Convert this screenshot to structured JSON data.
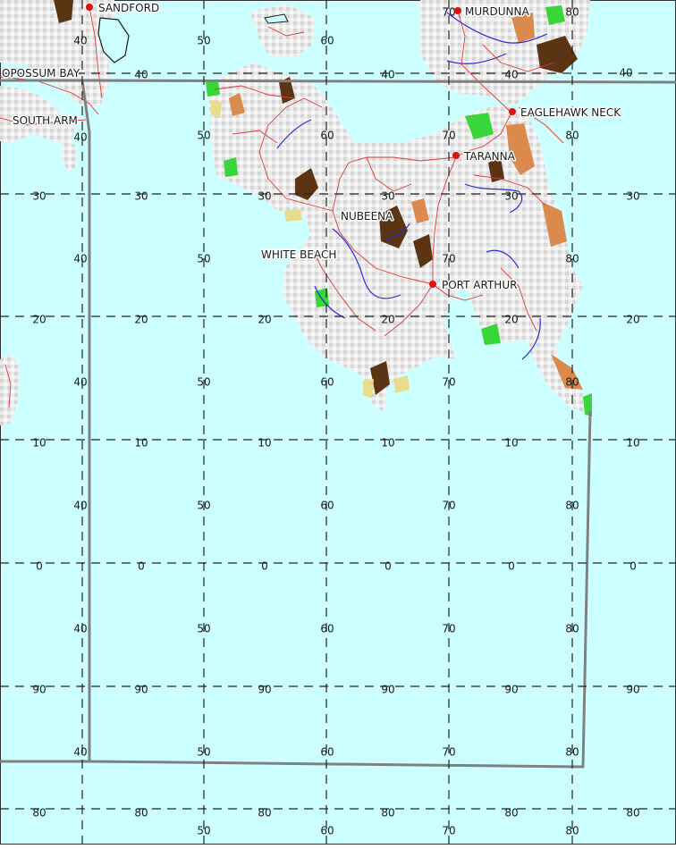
{
  "map": {
    "colors": {
      "sea": "#ccffff",
      "land": "#eeeeee",
      "hill": "#c8c8c8",
      "forest_dark": "#5a3413",
      "forest_orange": "#d98a4c",
      "grass_green": "#38d638",
      "sand_yellow": "#e9dc8c",
      "road": "#e0393b",
      "river": "#2b2bd6",
      "town_marker": "#dd1111",
      "grid": "#222222",
      "sheet_border": "#808080"
    },
    "places": [
      {
        "id": "sandford",
        "name": "SANDFORD"
      },
      {
        "id": "murdunna",
        "name": "MURDUNNA"
      },
      {
        "id": "opossum-bay",
        "name": "OPOSSUM BAY"
      },
      {
        "id": "south-arm",
        "name": "SOUTH ARM"
      },
      {
        "id": "eaglehawk-neck",
        "name": "EAGLEHAWK NECK"
      },
      {
        "id": "taranna",
        "name": "TARANNA"
      },
      {
        "id": "nubeena",
        "name": "NUBEENA"
      },
      {
        "id": "white-beach",
        "name": "WHITE BEACH"
      },
      {
        "id": "port-arthur",
        "name": "PORT ARTHUR"
      }
    ],
    "grid_labels": [
      {
        "id": "r1-a",
        "text": "40"
      },
      {
        "id": "r1-b",
        "text": "50"
      },
      {
        "id": "r1-c",
        "text": "60"
      },
      {
        "id": "r1-d",
        "text": "70"
      },
      {
        "id": "r1-e",
        "text": "80"
      },
      {
        "id": "r2-a",
        "text": "40"
      },
      {
        "id": "r2-b",
        "text": "40"
      },
      {
        "id": "r2-c",
        "text": "40"
      },
      {
        "id": "r2-d",
        "text": "40"
      },
      {
        "id": "r3-a",
        "text": "40"
      },
      {
        "id": "r3-b",
        "text": "50"
      },
      {
        "id": "r3-c",
        "text": "60"
      },
      {
        "id": "r3-d",
        "text": "70"
      },
      {
        "id": "r3-e",
        "text": "80"
      },
      {
        "id": "r4-a",
        "text": "30"
      },
      {
        "id": "r4-b",
        "text": "30"
      },
      {
        "id": "r4-c",
        "text": "30"
      },
      {
        "id": "r4-d",
        "text": "30"
      },
      {
        "id": "r4-e",
        "text": "30"
      },
      {
        "id": "r4-f",
        "text": "30"
      },
      {
        "id": "r5-a",
        "text": "40"
      },
      {
        "id": "r5-b",
        "text": "50"
      },
      {
        "id": "r5-c",
        "text": "70"
      },
      {
        "id": "r5-d",
        "text": "80"
      },
      {
        "id": "r6-a",
        "text": "20"
      },
      {
        "id": "r6-b",
        "text": "20"
      },
      {
        "id": "r6-c",
        "text": "20"
      },
      {
        "id": "r6-d",
        "text": "20"
      },
      {
        "id": "r6-e",
        "text": "20"
      },
      {
        "id": "r6-f",
        "text": "20"
      },
      {
        "id": "r7-a",
        "text": "40"
      },
      {
        "id": "r7-b",
        "text": "50"
      },
      {
        "id": "r7-c",
        "text": "60"
      },
      {
        "id": "r7-d",
        "text": "70"
      },
      {
        "id": "r7-e",
        "text": "80"
      },
      {
        "id": "r8-a",
        "text": "10"
      },
      {
        "id": "r8-b",
        "text": "10"
      },
      {
        "id": "r8-c",
        "text": "10"
      },
      {
        "id": "r8-d",
        "text": "10"
      },
      {
        "id": "r8-e",
        "text": "10"
      },
      {
        "id": "r8-f",
        "text": "10"
      },
      {
        "id": "r9-a",
        "text": "40"
      },
      {
        "id": "r9-b",
        "text": "50"
      },
      {
        "id": "r9-c",
        "text": "60"
      },
      {
        "id": "r9-d",
        "text": "70"
      },
      {
        "id": "r9-e",
        "text": "80"
      },
      {
        "id": "r10-a",
        "text": "0"
      },
      {
        "id": "r10-b",
        "text": "0"
      },
      {
        "id": "r10-c",
        "text": "0"
      },
      {
        "id": "r10-d",
        "text": "0"
      },
      {
        "id": "r10-e",
        "text": "0"
      },
      {
        "id": "r10-f",
        "text": "0"
      },
      {
        "id": "r11-a",
        "text": "40"
      },
      {
        "id": "r11-b",
        "text": "50"
      },
      {
        "id": "r11-c",
        "text": "60"
      },
      {
        "id": "r11-d",
        "text": "70"
      },
      {
        "id": "r11-e",
        "text": "80"
      },
      {
        "id": "r12-a",
        "text": "90"
      },
      {
        "id": "r12-b",
        "text": "90"
      },
      {
        "id": "r12-c",
        "text": "90"
      },
      {
        "id": "r12-d",
        "text": "90"
      },
      {
        "id": "r12-e",
        "text": "90"
      },
      {
        "id": "r12-f",
        "text": "90"
      },
      {
        "id": "r13-a",
        "text": "40"
      },
      {
        "id": "r13-b",
        "text": "50"
      },
      {
        "id": "r13-c",
        "text": "60"
      },
      {
        "id": "r13-d",
        "text": "70"
      },
      {
        "id": "r13-e",
        "text": "80"
      },
      {
        "id": "r14-a",
        "text": "80"
      },
      {
        "id": "r14-b",
        "text": "80"
      },
      {
        "id": "r14-c",
        "text": "80"
      },
      {
        "id": "r14-d",
        "text": "80"
      },
      {
        "id": "r14-e",
        "text": "80"
      },
      {
        "id": "r14-f",
        "text": "80"
      },
      {
        "id": "r15-a",
        "text": "50"
      },
      {
        "id": "r15-b",
        "text": "60"
      },
      {
        "id": "r15-c",
        "text": "70"
      },
      {
        "id": "r15-d",
        "text": "80"
      }
    ]
  }
}
